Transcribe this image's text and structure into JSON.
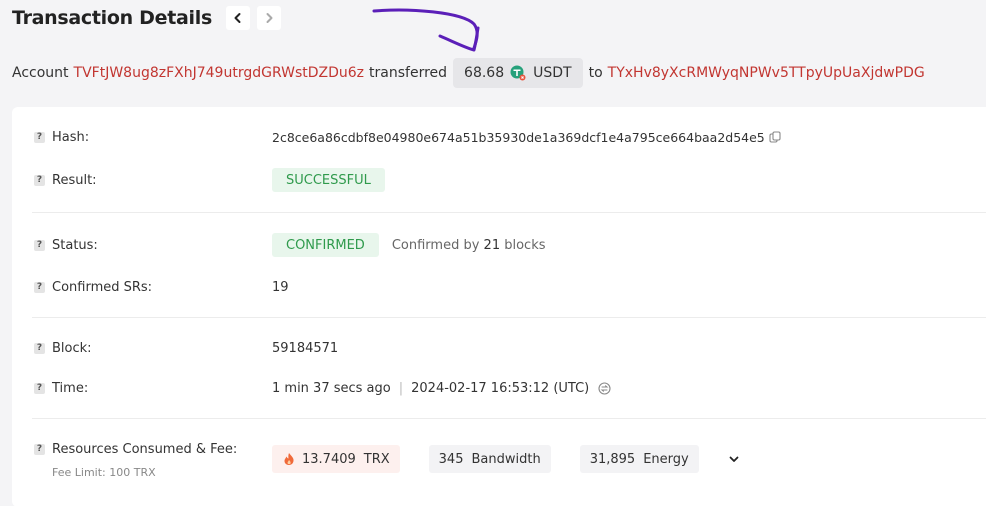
{
  "header": {
    "title": "Transaction Details"
  },
  "summary": {
    "account_label": "Account",
    "from_address": "TVFtJW8ug8zFXhJ749utrgdGRWstDZDu6z",
    "transferred_label": "transferred",
    "amount": "68.68",
    "token_symbol": "USDT",
    "to_label": "to",
    "to_address": "TYxHv8yXcRMWyqNPWv5TTpyUpUaXjdwPDG"
  },
  "details": {
    "hash_label": "Hash:",
    "hash_value": "2c8ce6a86cdbf8e04980e674a51b35930de1a369dcf1e4a795ce664baa2d54e5",
    "result_label": "Result:",
    "result_value": "SUCCESSFUL",
    "status_label": "Status:",
    "status_value": "CONFIRMED",
    "confirmed_by_prefix": "Confirmed by",
    "confirmed_by_count": "21",
    "confirmed_by_suffix": "blocks",
    "confirmed_srs_label": "Confirmed SRs:",
    "confirmed_srs_value": "19",
    "block_label": "Block:",
    "block_value": "59184571",
    "time_label": "Time:",
    "time_relative": "1 min 37 secs ago",
    "time_separator": "|",
    "time_absolute": "2024-02-17 16:53:12 (UTC)",
    "resources_label": "Resources Consumed & Fee:",
    "fee_limit": "Fee Limit: 100 TRX",
    "trx_amount": "13.7409",
    "trx_unit": "TRX",
    "bandwidth_amount": "345",
    "bandwidth_unit": "Bandwidth",
    "energy_amount": "31,895",
    "energy_unit": "Energy",
    "help_mark": "?"
  },
  "colors": {
    "address": "#c23631",
    "success_bg": "#e8f6ec",
    "success_text": "#2f9a4c",
    "annotation": "#5b1fb8"
  },
  "icons": [
    "chevron-left-icon",
    "chevron-right-icon",
    "usdt-token-icon",
    "copy-icon",
    "clock-icon",
    "flame-icon",
    "chevron-down-icon"
  ]
}
